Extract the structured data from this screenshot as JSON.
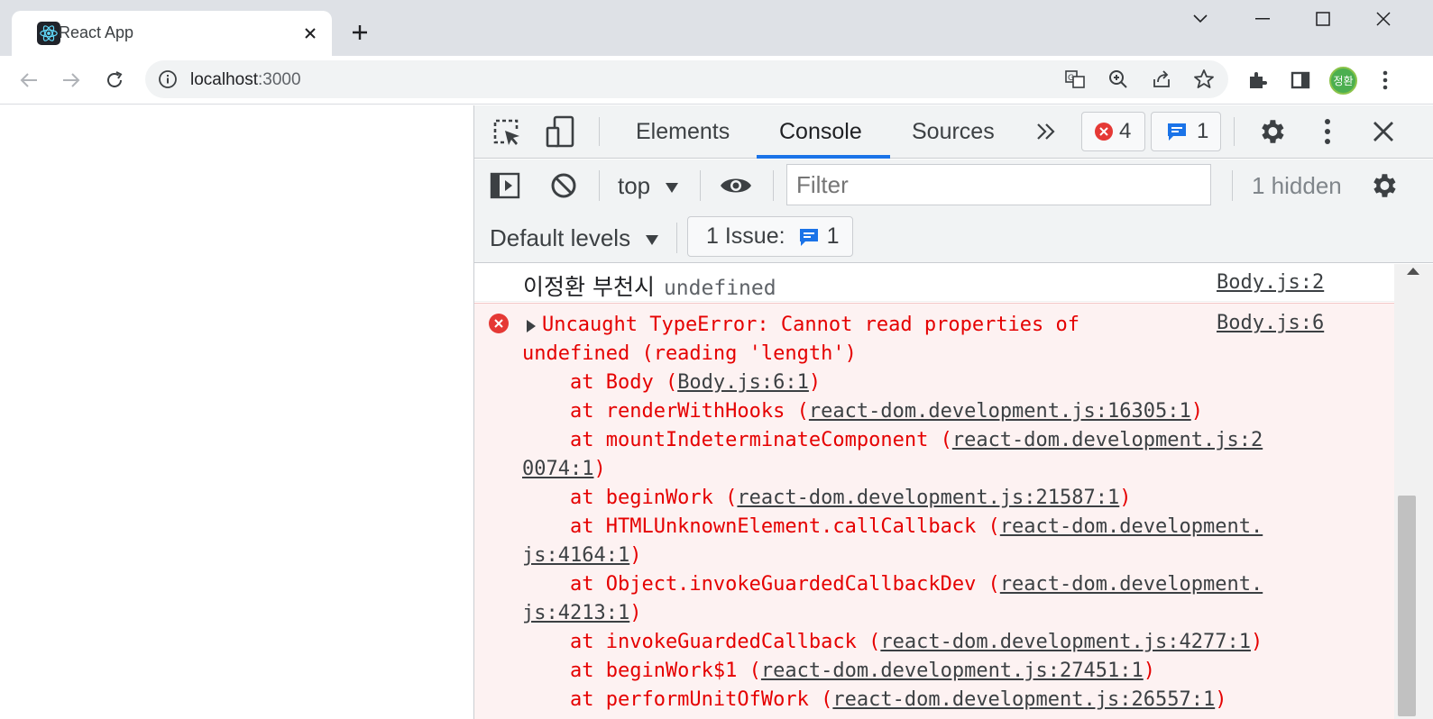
{
  "browser": {
    "tab_title": "React App",
    "url_host": "localhost",
    "url_port": ":3000",
    "avatar_text": "정환"
  },
  "devtools": {
    "tabs": [
      {
        "label": "Elements"
      },
      {
        "label": "Console"
      },
      {
        "label": "Sources"
      }
    ],
    "error_badge_count": "4",
    "message_badge_count": "1",
    "context": "top",
    "filter_placeholder": "Filter",
    "hidden_label": "1 hidden",
    "levels_label": "Default levels",
    "issues_label": "1 Issue:",
    "issues_count": "1"
  },
  "console": {
    "log": {
      "text": "이정환 부천시",
      "value": "undefined",
      "source": "Body.js:2"
    },
    "error": {
      "source": "Body.js:6",
      "lines": [
        {
          "text": "Uncaught TypeError: Cannot read properties of",
          "link": "",
          "close": ""
        },
        {
          "text": "undefined (reading 'length')",
          "link": "",
          "close": ""
        },
        {
          "text": "    at Body (",
          "link": "Body.js:6:1",
          "close": ")"
        },
        {
          "text": "    at renderWithHooks (",
          "link": "react-dom.development.js:16305:1",
          "close": ")"
        },
        {
          "text": "    at mountIndeterminateComponent (",
          "link": "react-dom.development.js:2",
          "close": ""
        },
        {
          "text": "",
          "link": "0074:1",
          "close": ")"
        },
        {
          "text": "    at beginWork (",
          "link": "react-dom.development.js:21587:1",
          "close": ")"
        },
        {
          "text": "    at HTMLUnknownElement.callCallback (",
          "link": "react-dom.development.",
          "close": ""
        },
        {
          "text": "",
          "link": "js:4164:1",
          "close": ")"
        },
        {
          "text": "    at Object.invokeGuardedCallbackDev (",
          "link": "react-dom.development.",
          "close": ""
        },
        {
          "text": "",
          "link": "js:4213:1",
          "close": ")"
        },
        {
          "text": "    at invokeGuardedCallback (",
          "link": "react-dom.development.js:4277:1",
          "close": ")"
        },
        {
          "text": "    at beginWork$1 (",
          "link": "react-dom.development.js:27451:1",
          "close": ")"
        },
        {
          "text": "    at performUnitOfWork (",
          "link": "react-dom.development.js:26557:1",
          "close": ")"
        }
      ]
    }
  },
  "colors": {
    "accent": "#1a73e8",
    "error": "#e50000",
    "error_bg": "#fdf2f2"
  }
}
